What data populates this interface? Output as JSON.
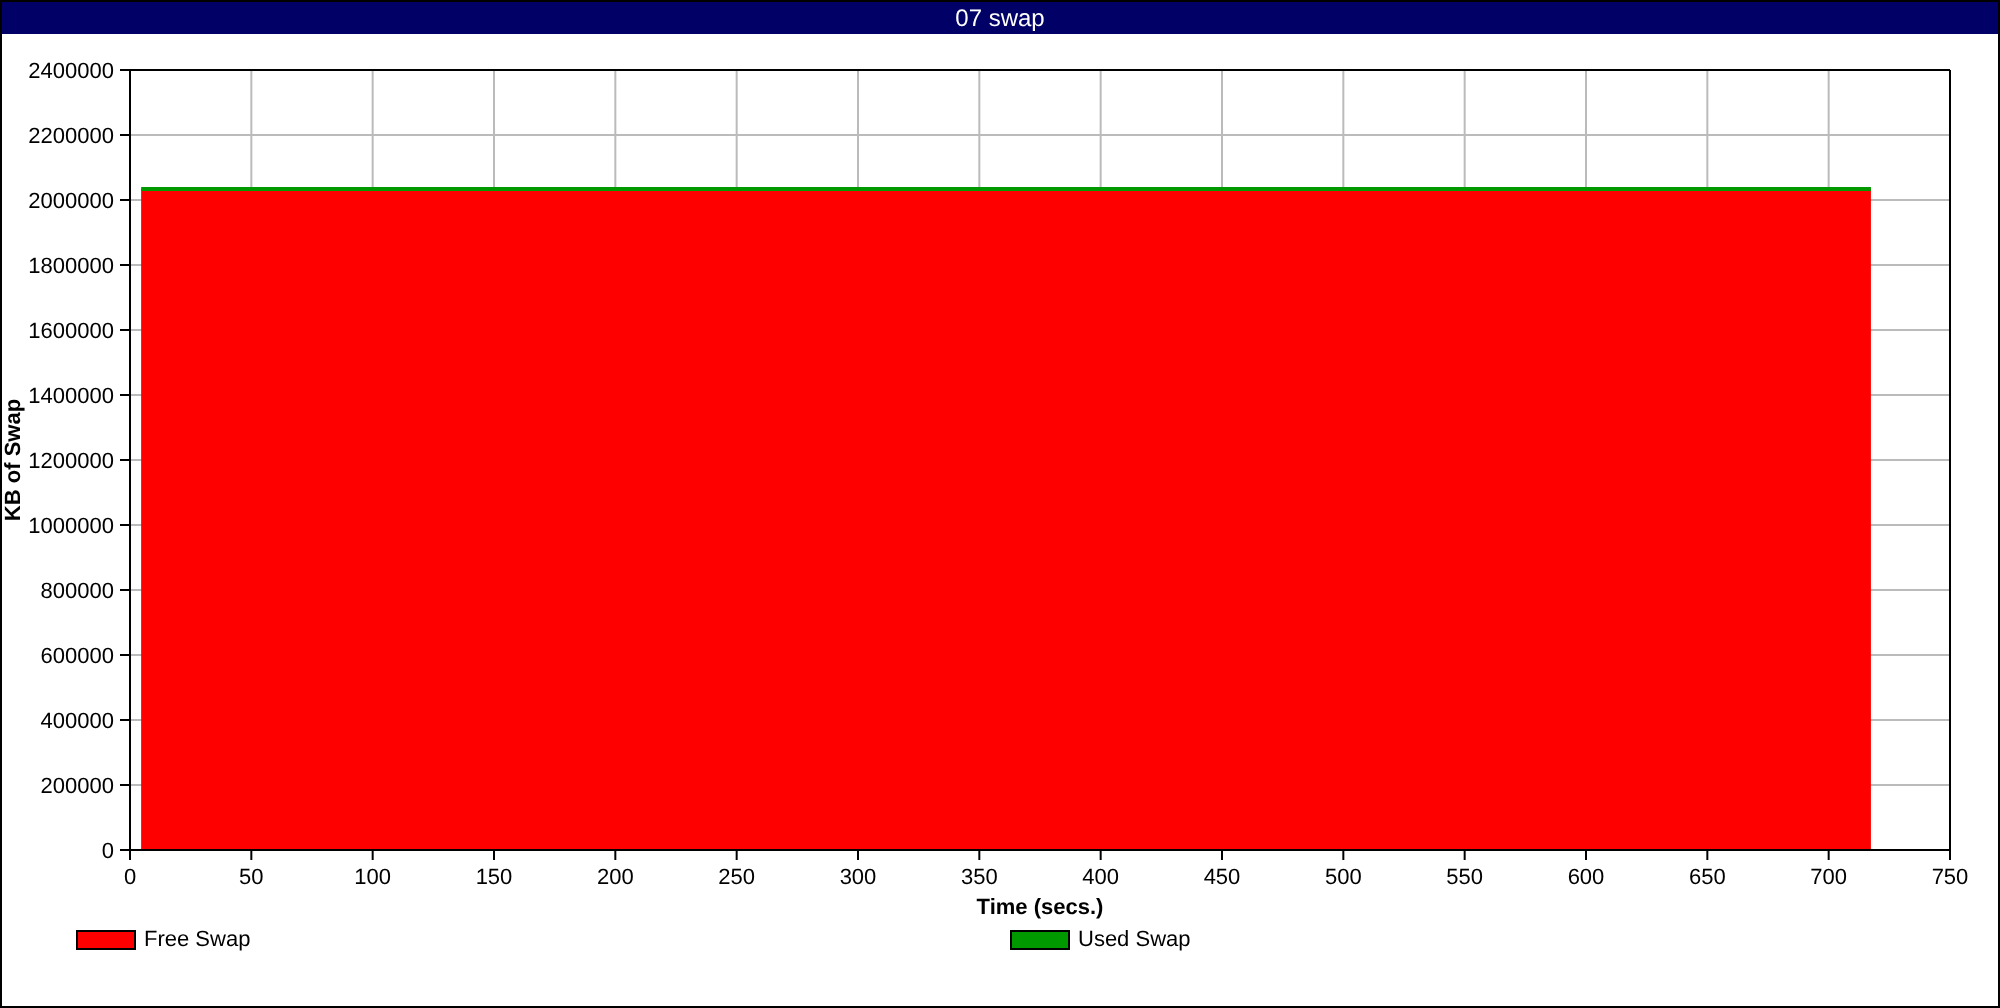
{
  "window": {
    "title": "07 swap"
  },
  "chart": {
    "chart_data": {
      "type": "area",
      "xlabel": "Time (secs.)",
      "ylabel": "KB of Swap",
      "stacked": true,
      "grid": true,
      "x": [
        5,
        717
      ],
      "series": [
        {
          "name": "Free Swap",
          "color": "#ff0000",
          "values": [
            2031000,
            2031000
          ]
        },
        {
          "name": "Used Swap",
          "color": "#009900",
          "values": [
            6000,
            6000
          ]
        }
      ],
      "xlim": [
        0,
        750
      ],
      "ylim": [
        0,
        2400000
      ],
      "xticks": [
        0,
        50,
        100,
        150,
        200,
        250,
        300,
        350,
        400,
        450,
        500,
        550,
        600,
        650,
        700,
        750
      ],
      "yticks": [
        0,
        200000,
        400000,
        600000,
        800000,
        1000000,
        1200000,
        1400000,
        1600000,
        1800000,
        2000000,
        2200000,
        2400000
      ]
    }
  }
}
